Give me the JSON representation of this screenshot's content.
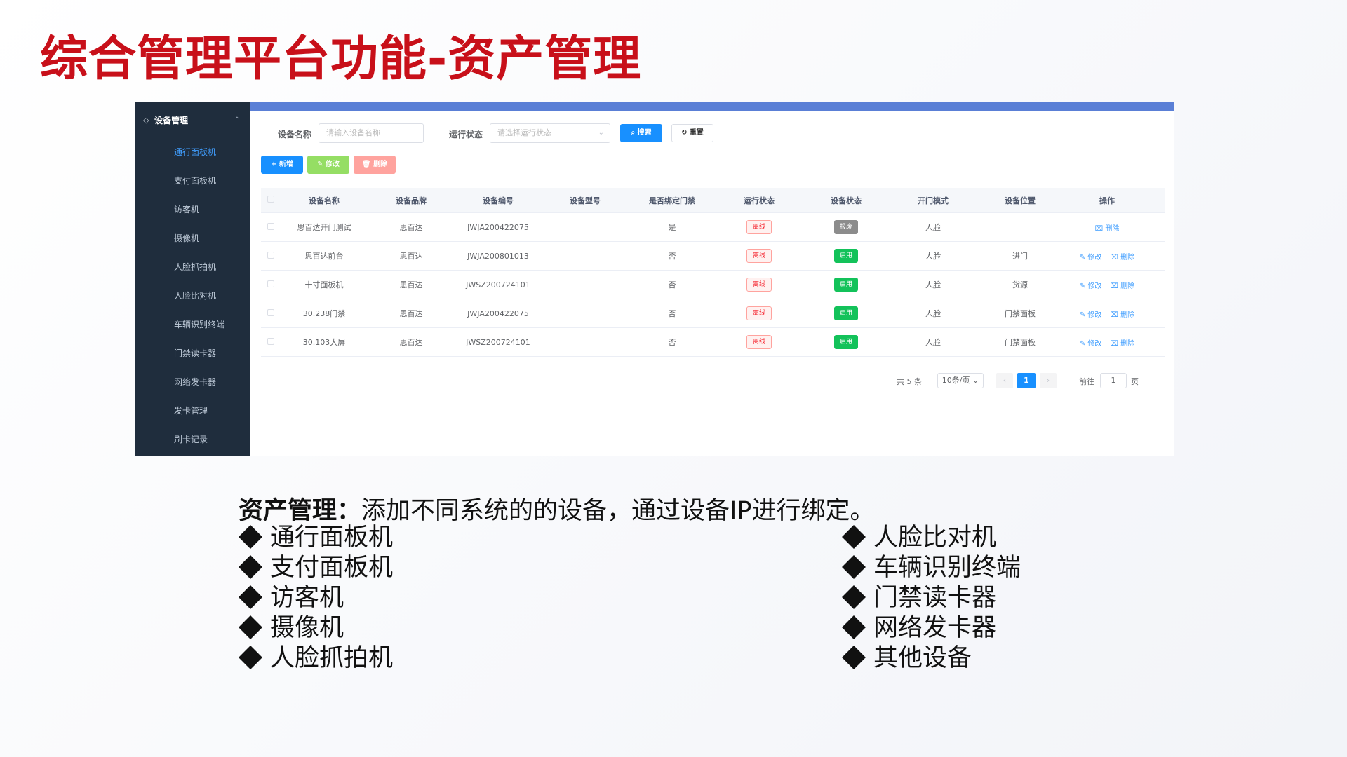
{
  "slide": {
    "title": "综合管理平台功能-资产管理",
    "desc_bold": "资产管理：",
    "desc_text": "添加不同系统的的设备，通过设备IP进行绑定。",
    "list_left": [
      "通行面板机",
      "支付面板机",
      "访客机",
      "摄像机",
      "人脸抓拍机"
    ],
    "list_right": [
      "人脸比对机",
      "车辆识别终端",
      "门禁读卡器",
      "网络发卡器",
      "其他设备"
    ]
  },
  "sidebar": {
    "header": "设备管理",
    "items": [
      "通行面板机",
      "支付面板机",
      "访客机",
      "摄像机",
      "人脸抓拍机",
      "人脸比对机",
      "车辆识别终端",
      "门禁读卡器",
      "网络发卡器",
      "发卡管理",
      "刷卡记录"
    ],
    "active_index": 0
  },
  "filters": {
    "name_label": "设备名称",
    "name_placeholder": "请输入设备名称",
    "status_label": "运行状态",
    "status_placeholder": "请选择运行状态",
    "search": "搜索",
    "reset": "重置"
  },
  "toolbar": {
    "add": "+ 新增",
    "edit": "修改",
    "delete": "删除"
  },
  "table": {
    "headers": [
      "设备名称",
      "设备品牌",
      "设备编号",
      "设备型号",
      "是否绑定门禁",
      "运行状态",
      "设备状态",
      "开门模式",
      "设备位置",
      "操作"
    ],
    "rows": [
      {
        "name": "思百达开门测试",
        "brand": "思百达",
        "code": "JWJA200422075",
        "model": "",
        "bound": "是",
        "run": "离线",
        "state": "报废",
        "mode": "人脸",
        "loc": "",
        "ops": [
          "删除"
        ]
      },
      {
        "name": "思百达前台",
        "brand": "思百达",
        "code": "JWJA200801013",
        "model": "",
        "bound": "否",
        "run": "离线",
        "state": "启用",
        "mode": "人脸",
        "loc": "进门",
        "ops": [
          "修改",
          "删除"
        ]
      },
      {
        "name": "十寸面板机",
        "brand": "思百达",
        "code": "JWSZ200724101",
        "model": "",
        "bound": "否",
        "run": "离线",
        "state": "启用",
        "mode": "人脸",
        "loc": "货源",
        "ops": [
          "修改",
          "删除"
        ]
      },
      {
        "name": "30.238门禁",
        "brand": "思百达",
        "code": "JWJA200422075",
        "model": "",
        "bound": "否",
        "run": "离线",
        "state": "启用",
        "mode": "人脸",
        "loc": "门禁面板",
        "ops": [
          "修改",
          "删除"
        ]
      },
      {
        "name": "30.103大屏",
        "brand": "思百达",
        "code": "JWSZ200724101",
        "model": "",
        "bound": "否",
        "run": "离线",
        "state": "启用",
        "mode": "人脸",
        "loc": "门禁面板",
        "ops": [
          "修改",
          "删除"
        ]
      }
    ]
  },
  "pager": {
    "total": "共 5 条",
    "size": "10条/页",
    "page": "1",
    "goto_label": "前往",
    "goto_value": "1",
    "page_unit": "页"
  },
  "colors": {
    "title_red": "#c8101a",
    "sidebar_bg": "#1f2d3d",
    "primary": "#1890ff",
    "enabled": "#13c25a",
    "scrapped": "#8c8c8c",
    "offline": "#f5222d"
  }
}
